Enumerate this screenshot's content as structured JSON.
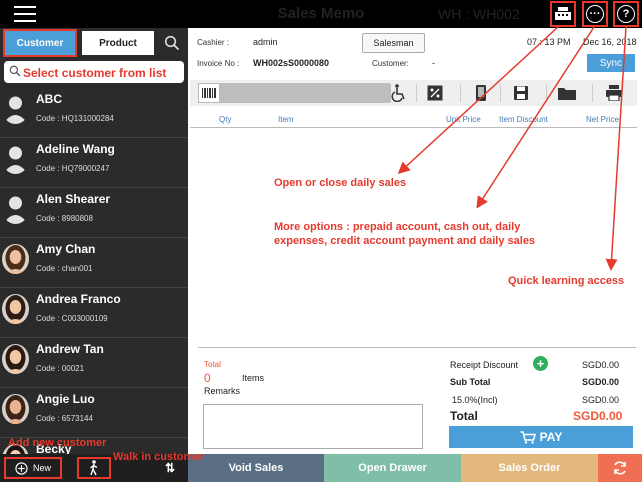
{
  "header": {
    "title": "Sales Memo",
    "warehouse": "WH : WH002"
  },
  "sidebar": {
    "tabs": [
      "Customer",
      "Product"
    ],
    "search_placeholder": "Select customer from list",
    "customers": [
      {
        "name": "ABC",
        "code": "Code : HQ131000284",
        "photo": false
      },
      {
        "name": "Adeline Wang",
        "code": "Code : HQ79000247",
        "photo": false
      },
      {
        "name": "Alen Shearer",
        "code": "Code : 8980808",
        "photo": false
      },
      {
        "name": "Amy Chan",
        "code": "Code : chan001",
        "photo": true
      },
      {
        "name": "Andrea Franco",
        "code": "Code : C003000109",
        "photo": true
      },
      {
        "name": "Andrew Tan",
        "code": "Code : 00021",
        "photo": true
      },
      {
        "name": "Angie Luo",
        "code": "Code : 6573144",
        "photo": true
      },
      {
        "name": "Becky",
        "code": "",
        "photo": true
      }
    ],
    "new_label": "New"
  },
  "info": {
    "cashier_label": "Cashier :",
    "cashier_value": "admin",
    "invoice_label": "Invoice No :",
    "invoice_value": "WH002sS0000080",
    "customer_label": "Customer:",
    "customer_value": "-",
    "salesman_label": "Salesman",
    "time": "07 : 13 PM",
    "date": "Dec 16, 2018",
    "sync_label": "Sync"
  },
  "table": {
    "columns": [
      "Qty",
      "Item",
      "Unit Price",
      "Item Discount",
      "Net Price"
    ]
  },
  "footer": {
    "total_label": "Total",
    "total_count": "0",
    "items_label": "Items",
    "remarks_label": "Remarks",
    "receipt_discount_label": "Receipt Discount",
    "receipt_discount_value": "SGD0.00",
    "subtotal_label": "Sub Total",
    "subtotal_value": "SGD0.00",
    "tax_label": "15.0%(Incl)",
    "tax_value": "SGD0.00",
    "grand_total_label": "Total",
    "grand_total_value": "SGD0.00",
    "pay_label": "PAY"
  },
  "bottom_bar": {
    "void": "Void Sales",
    "drawer": "Open Drawer",
    "order": "Sales Order"
  },
  "annotations": {
    "daily_sales": "Open or close daily sales",
    "more_options_1": "More options : prepaid account, cash out, daily",
    "more_options_2": "expenses, credit account payment and daily sales",
    "quick_learning": "Quick learning access",
    "add_customer": "Add new customer",
    "walk_in": "Walk in customer"
  },
  "colors": {
    "accent": "#4a9fd8",
    "annotation": "#e53a2d",
    "open_drawer": "#7fbfa8",
    "sales_order": "#e3b87c",
    "refresh": "#ef6f55",
    "total_red": "#ef5a3c"
  }
}
